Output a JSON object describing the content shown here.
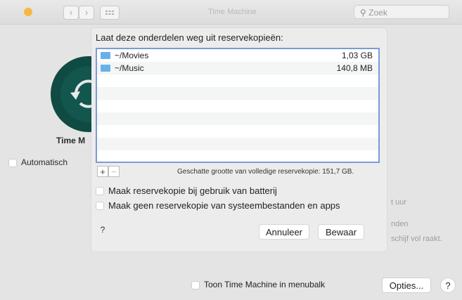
{
  "window": {
    "title": "Time Machine",
    "search_placeholder": "Zoek",
    "traffic_color": "#f5b843"
  },
  "background": {
    "app_label": "Time M",
    "auto_label": "Automatisch",
    "right_text_1": "t uur",
    "right_text_2": "nden",
    "right_text_3": "schijf vol raakt.",
    "menubar_checkbox_label": "Toon Time Machine in menubalk",
    "options_button": "Opties...",
    "help_button": "?"
  },
  "sheet": {
    "title": "Laat deze onderdelen weg uit reservekopieën:",
    "items": [
      {
        "name": "~/Movies",
        "size": "1,03 GB"
      },
      {
        "name": "~/Music",
        "size": "140,8 MB"
      }
    ],
    "add_label": "+",
    "remove_label": "−",
    "estimate": "Geschatte grootte van volledige reservekopie: 151,7 GB.",
    "options": [
      {
        "label": "Maak reservekopie bij gebruik van batterij",
        "checked": false
      },
      {
        "label": "Maak geen reservekopie van systeembestanden en apps",
        "checked": false
      }
    ],
    "help_label": "?",
    "cancel_label": "Annuleer",
    "save_label": "Bewaar"
  }
}
